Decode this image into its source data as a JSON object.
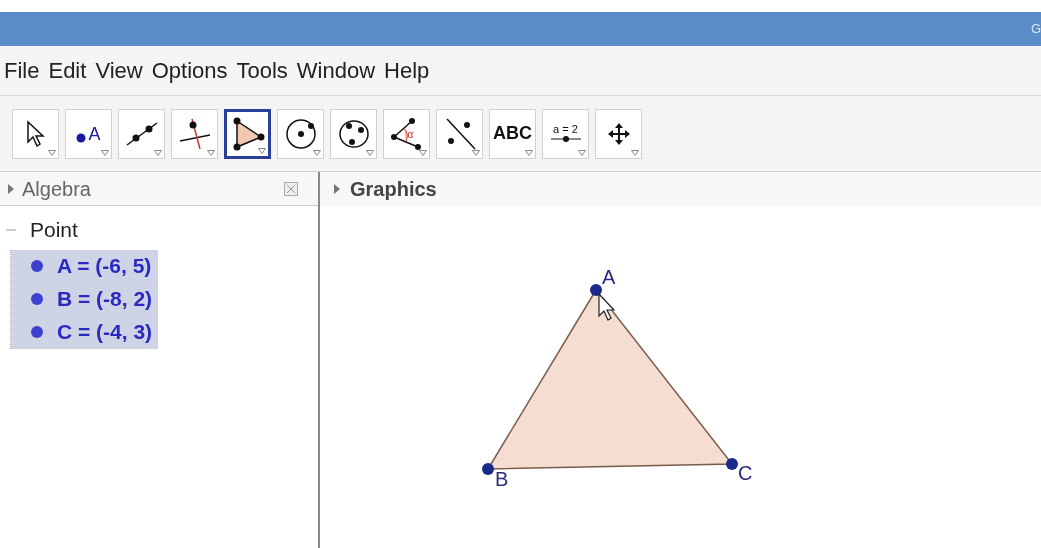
{
  "window": {
    "title": "G"
  },
  "menu": [
    "File",
    "Edit",
    "View",
    "Options",
    "Tools",
    "Window",
    "Help"
  ],
  "toolbar": [
    {
      "kind": "move",
      "selected": false
    },
    {
      "kind": "point",
      "label": "A",
      "selected": false
    },
    {
      "kind": "line",
      "selected": false
    },
    {
      "kind": "perpendicular",
      "selected": false
    },
    {
      "kind": "polygon",
      "selected": true
    },
    {
      "kind": "circle",
      "selected": false
    },
    {
      "kind": "conic",
      "selected": false
    },
    {
      "kind": "angle",
      "label": "α",
      "selected": false
    },
    {
      "kind": "reflect",
      "selected": false
    },
    {
      "kind": "text",
      "label": "ABC",
      "selected": false
    },
    {
      "kind": "slider",
      "label": "a = 2",
      "selected": false
    },
    {
      "kind": "move-view",
      "selected": false
    }
  ],
  "algebra": {
    "title": "Algebra",
    "groups": [
      {
        "label": "Point",
        "expanded": true,
        "items": [
          {
            "text": "A = (-6, 5)",
            "selected": true,
            "color": "#4040d0"
          },
          {
            "text": "B = (-8, 2)",
            "selected": true,
            "color": "#4040d0"
          },
          {
            "text": "C = (-4, 3)",
            "selected": true,
            "color": "#4040d0"
          }
        ]
      }
    ]
  },
  "graphics": {
    "title": "Graphics",
    "points": [
      {
        "label": "A"
      },
      {
        "label": "B"
      },
      {
        "label": "C"
      }
    ]
  }
}
